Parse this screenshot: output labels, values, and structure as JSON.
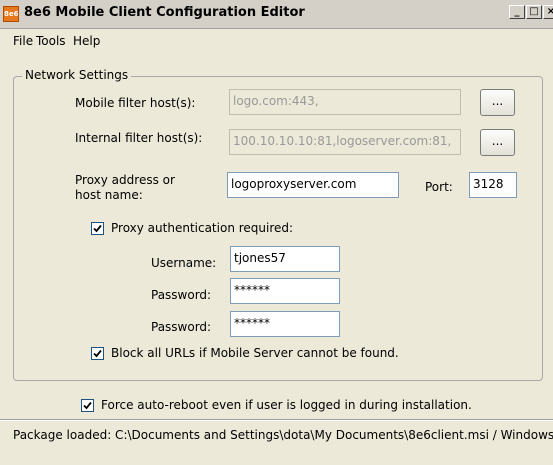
{
  "window": {
    "title": "8e6 Mobile Client Configuration Editor",
    "app_icon_text": "8e6",
    "minimize": "_",
    "maximize": "□",
    "close": "×"
  },
  "menu": {
    "file": "File",
    "tools": "Tools",
    "help": "Help"
  },
  "network": {
    "group_label": "Network Settings",
    "mobile_filter_label": "Mobile filter host(s):",
    "mobile_filter_value": "logo.com:443,",
    "internal_filter_label": "Internal filter host(s):",
    "internal_filter_value": "100.10.10.10:81,logoserver.com:81,",
    "browse_label": "...",
    "proxy_label_line1": "Proxy address or",
    "proxy_label_line2": "host name:",
    "proxy_value": "logoproxyserver.com",
    "port_label": "Port:",
    "port_value": "3128",
    "proxy_auth_label": "Proxy authentication required:",
    "username_label": "Username:",
    "username_value": "tjones57",
    "password_label": "Password:",
    "password_value": "******",
    "password_confirm_label": "Password:",
    "password_confirm_value": "******",
    "block_urls_label": "Block all URLs if Mobile Server cannot be found."
  },
  "force_reboot_label": "Force auto-reboot even if user is logged in during installation.",
  "status": "Package loaded: C:\\Documents and Settings\\dota\\My Documents\\8e6client.msi / Windows"
}
